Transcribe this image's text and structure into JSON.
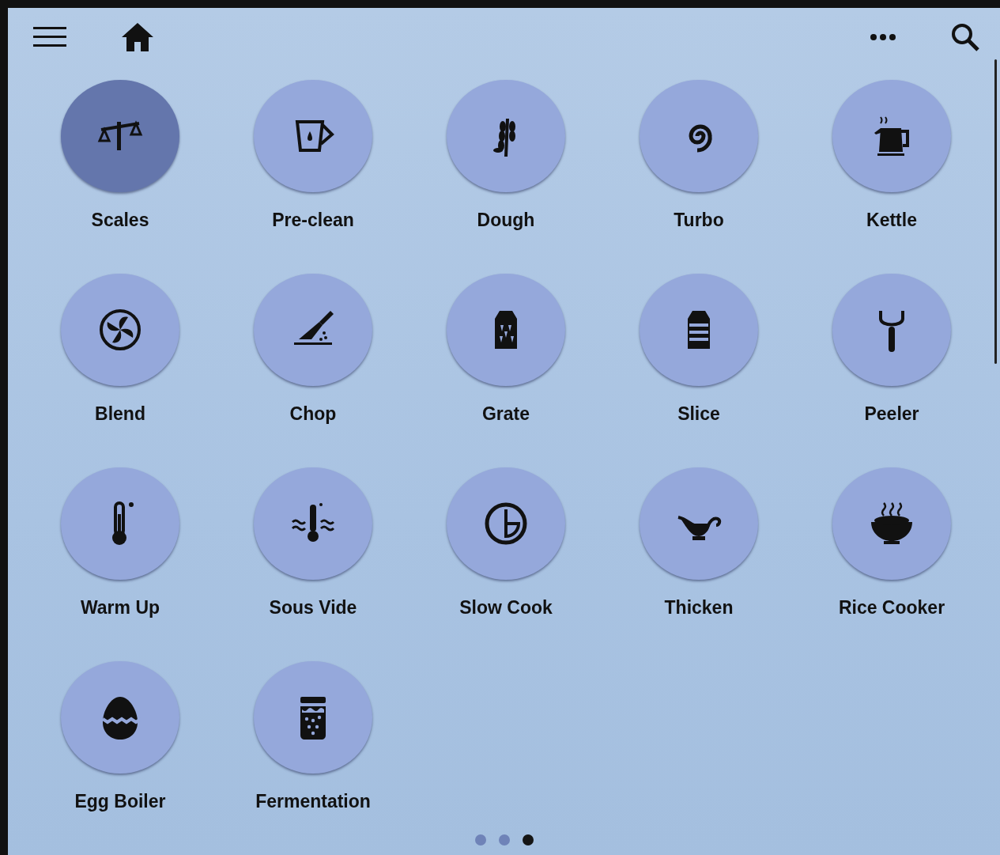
{
  "modes": [
    {
      "label": "Scales",
      "kind": "scales",
      "selected": true
    },
    {
      "label": "Pre-clean",
      "kind": "cup",
      "selected": false
    },
    {
      "label": "Dough",
      "kind": "wheat",
      "selected": false
    },
    {
      "label": "Turbo",
      "kind": "spiral",
      "selected": false
    },
    {
      "label": "Kettle",
      "kind": "kettle",
      "selected": false
    },
    {
      "label": "Blend",
      "kind": "fan",
      "selected": false
    },
    {
      "label": "Chop",
      "kind": "knife",
      "selected": false
    },
    {
      "label": "Grate",
      "kind": "grater",
      "selected": false
    },
    {
      "label": "Slice",
      "kind": "slicer",
      "selected": false
    },
    {
      "label": "Peeler",
      "kind": "peeler",
      "selected": false
    },
    {
      "label": "Warm Up",
      "kind": "thermometer",
      "selected": false
    },
    {
      "label": "Sous Vide",
      "kind": "sousvide",
      "selected": false
    },
    {
      "label": "Slow Cook",
      "kind": "clock",
      "selected": false
    },
    {
      "label": "Thicken",
      "kind": "gravy",
      "selected": false
    },
    {
      "label": "Rice Cooker",
      "kind": "bowl",
      "selected": false
    },
    {
      "label": "Egg Boiler",
      "kind": "egg",
      "selected": false
    },
    {
      "label": "Fermentation",
      "kind": "jar",
      "selected": false
    }
  ],
  "pages": [
    {
      "selected": false
    },
    {
      "selected": false
    },
    {
      "selected": true
    }
  ]
}
